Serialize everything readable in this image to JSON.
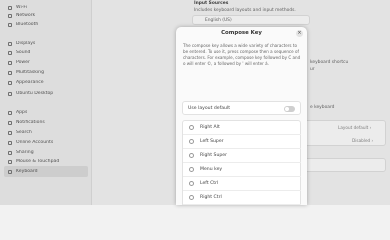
{
  "sidebar": {
    "items": [
      {
        "label": "Wi-Fi",
        "icon": "wifi-icon"
      },
      {
        "label": "Network",
        "icon": "network-icon"
      },
      {
        "label": "Bluetooth",
        "icon": "bluetooth-icon"
      },
      {
        "label": "Displays",
        "icon": "display-icon"
      },
      {
        "label": "Sound",
        "icon": "sound-icon"
      },
      {
        "label": "Power",
        "icon": "power-icon"
      },
      {
        "label": "Multitasking",
        "icon": "multitasking-icon"
      },
      {
        "label": "Appearance",
        "icon": "appearance-icon"
      },
      {
        "label": "Ubuntu Desktop",
        "icon": "ubuntu-icon"
      },
      {
        "label": "Apps",
        "icon": "apps-icon"
      },
      {
        "label": "Notifications",
        "icon": "bell-icon"
      },
      {
        "label": "Search",
        "icon": "search-icon"
      },
      {
        "label": "Online Accounts",
        "icon": "online-accounts-icon"
      },
      {
        "label": "Sharing",
        "icon": "sharing-icon"
      },
      {
        "label": "Mouse & Touchpad",
        "icon": "mouse-icon"
      },
      {
        "label": "Keyboard",
        "icon": "keyboard-icon",
        "active": true
      }
    ]
  },
  "main": {
    "input_sources_title": "Input Sources",
    "input_sources_desc": "Includes keyboard layouts and input methods.",
    "input_source_item": "English (US)",
    "right_fragment": "keyboard shortcu",
    "right_fragment2": "ur",
    "keyboard_fragment": "e keyboard",
    "layout_default": "Layout default",
    "disabled": "Disabled"
  },
  "dialog": {
    "title": "Compose Key",
    "close_glyph": "×",
    "description": "The compose key allows a wide variety of characters to be entered. To use it, press compose then a sequence of characters. For example, compose key followed by C and o will enter ©, a followed by ' will enter á.",
    "toggle_label": "Use layout default",
    "toggle_on": false,
    "options": [
      "Right Alt",
      "Left Super",
      "Right Super",
      "Menu key",
      "Left Ctrl",
      "Right Ctrl"
    ]
  }
}
